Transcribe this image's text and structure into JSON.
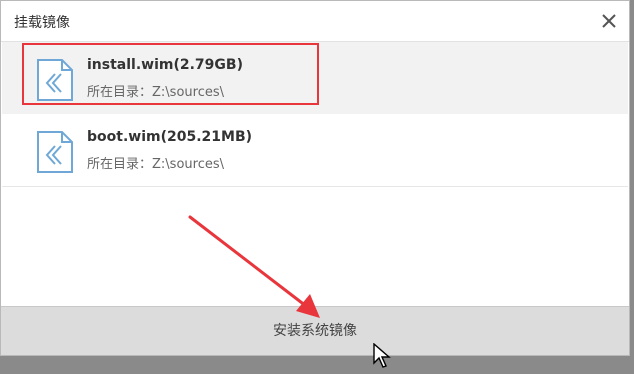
{
  "dialog": {
    "title": "挂载镜像",
    "close_icon": "close-icon"
  },
  "images": [
    {
      "name": "install.wim(2.79GB)",
      "path": "所在目录：Z:\\sources\\",
      "icon": "wim-file-icon",
      "selected": true
    },
    {
      "name": "boot.wim(205.21MB)",
      "path": "所在目录：Z:\\sources\\",
      "icon": "wim-file-icon",
      "selected": false
    }
  ],
  "actions": {
    "install_label": "安装系统镜像"
  },
  "colors": {
    "highlight": "#e8363c",
    "arrow": "#e8363c",
    "icon": "#6fa8d6",
    "button_bg": "#dcdcdc"
  }
}
